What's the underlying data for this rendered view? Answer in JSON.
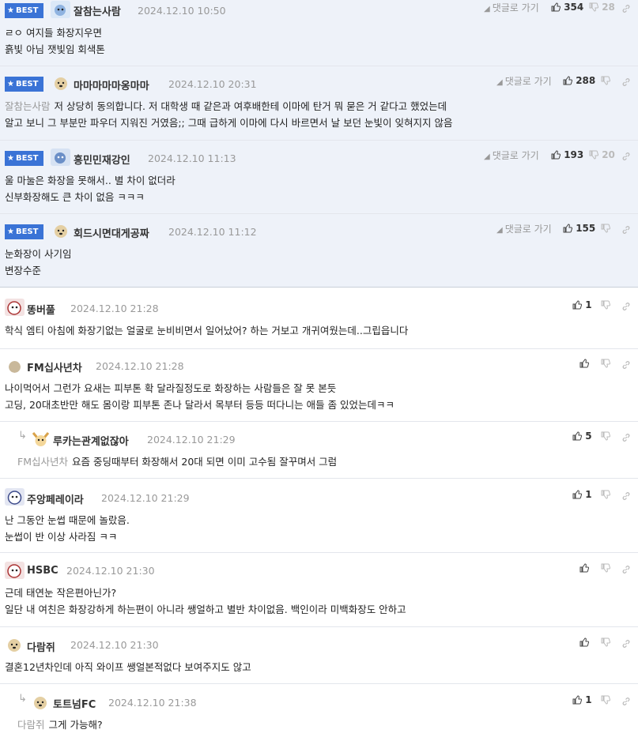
{
  "badge_label": "BEST",
  "reply_link_label": "댓글로 가기",
  "comments": [
    {
      "nick": "잘참는사람",
      "date": "2024.12.10 10:50",
      "up": "354",
      "down": "28",
      "lines": [
        "ㄹㅇ 여지들 화장지우면",
        "흙빛 아님 잿빛임 회색톤"
      ]
    },
    {
      "nick": "마마마마마옹마마",
      "date": "2024.12.10 20:31",
      "up": "288",
      "down": "",
      "mention": "잘참는사람",
      "lines": [
        "저 상당히 동의합니다. 저 대학생 때 같은과 여후배한테 이마에 탄거 뭐 묻은 거 같다고 했었는데",
        "알고 보니 그 부분만 파우더 지워진 거였음;; 그때 급하게 이마에 다시 바르면서 날 보던 눈빛이 잊혀지지 않음"
      ]
    },
    {
      "nick": "흥민민재강인",
      "date": "2024.12.10 11:13",
      "up": "193",
      "down": "20",
      "lines": [
        "울 마눌은 화장을 못해서.. 별 차이 없더라",
        "신부화장해도 큰 차이 없음 ㅋㅋㅋ"
      ]
    },
    {
      "nick": "회드시면대게공짜",
      "date": "2024.12.10 11:12",
      "up": "155",
      "down": "",
      "lines": [
        "눈화장이 사기임",
        "변장수준"
      ]
    },
    {
      "nick": "똥버풀",
      "date": "2024.12.10 21:28",
      "up": "1",
      "down": "",
      "lines": [
        "학식 엠티 아침에 화장기없는 얼굴로 눈비비면서 일어났어? 하는 거보고 개귀여웠는데..그립읍니다"
      ]
    },
    {
      "nick": "FM십사년차",
      "date": "2024.12.10 21:28",
      "up": "",
      "down": "",
      "lines": [
        "나이먹어서 그런가 요새는 피부톤 확 달라질정도로 화장하는 사람들은 잘 못 본듯",
        "고딩, 20대초반만 해도 몸이랑 피부톤 존나 달라서 목부터 등등 떠다니는 애들 좀 있었는데ㅋㅋ"
      ]
    },
    {
      "nick": "루카는관계없잖아",
      "date": "2024.12.10 21:29",
      "up": "5",
      "down": "",
      "mention": "FM십사년차",
      "lines": [
        "요즘 중딩때부터 화장해서 20대 되면 이미 고수됨 잘꾸며서 그럼"
      ]
    },
    {
      "nick": "주앙페레이라",
      "date": "2024.12.10 21:29",
      "up": "1",
      "down": "",
      "lines": [
        "난 그동안 눈썹 때문에 놀랐음.",
        "눈썹이 반 이상 사라짐 ㅋㅋ"
      ]
    },
    {
      "nick": "HSBC",
      "date": "2024.12.10 21:30",
      "up": "",
      "down": "",
      "lines": [
        "근데 태연눈 작은편아닌가?",
        "일단 내 여친은 화장강하게 하는편이 아니라 쌩얼하고 별반 차이없음. 백인이라 미백화장도 안하고"
      ]
    },
    {
      "nick": "다람쥐",
      "date": "2024.12.10 21:30",
      "up": "",
      "down": "",
      "lines": [
        "결혼12년차인데 아직 와이프 쌩얼본적없다 보여주지도 않고"
      ]
    },
    {
      "nick": "토트넘FC",
      "date": "2024.12.10 21:38",
      "up": "1",
      "down": "",
      "mention": "다람쥐",
      "lines": [
        "그게 가능해?"
      ]
    }
  ]
}
